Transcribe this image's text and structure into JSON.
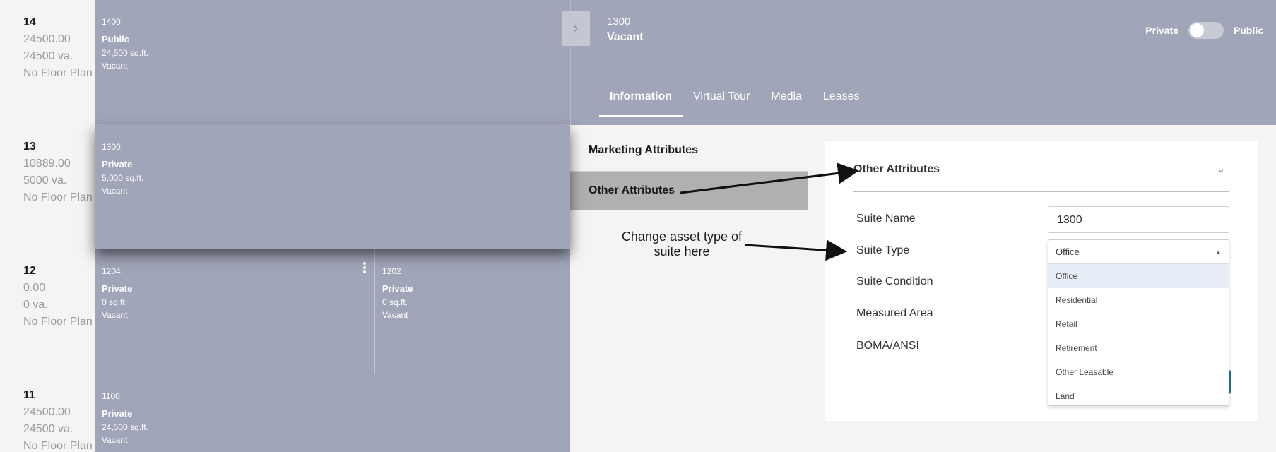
{
  "floors": [
    {
      "number": "14",
      "area": "24500.00",
      "va": "24500 va.",
      "plan": "No Floor Plan"
    },
    {
      "number": "13",
      "area": "10889.00",
      "va": "5000 va.",
      "plan": "No Floor Plan"
    },
    {
      "number": "12",
      "area": "0.00",
      "va": "0 va.",
      "plan": "No Floor Plan"
    },
    {
      "number": "11",
      "area": "24500.00",
      "va": "24500 va.",
      "plan": "No Floor Plan"
    }
  ],
  "suites": [
    {
      "number": "1400",
      "type": "Public",
      "size": "24,500 sq.ft.",
      "status": "Vacant"
    },
    {
      "number": "1300",
      "type": "Private",
      "size": "5,000 sq.ft.",
      "status": "Vacant"
    },
    {
      "number": "1204",
      "type": "Private",
      "size": "0 sq.ft.",
      "status": "Vacant"
    },
    {
      "number": "1202",
      "type": "Private",
      "size": "0 sq.ft.",
      "status": "Vacant"
    },
    {
      "number": "1100",
      "type": "Private",
      "size": "24,500 sq.ft.",
      "status": "Vacant"
    }
  ],
  "panel": {
    "suite_number": "1300",
    "status": "Vacant",
    "toggle": {
      "left": "Private",
      "right": "Public"
    },
    "tabs": [
      "Information",
      "Virtual Tour",
      "Media",
      "Leases"
    ],
    "side_nav": [
      "Marketing Attributes",
      "Other Attributes"
    ],
    "section_title": "Other Attributes",
    "fields": {
      "suite_name_label": "Suite Name",
      "suite_name_value": "1300",
      "suite_type_label": "Suite Type",
      "suite_condition_label": "Suite Condition",
      "measured_area_label": "Measured Area",
      "boma_label": "BOMA/ANSI"
    },
    "suite_type_selected": "Office",
    "suite_type_options": [
      "Office",
      "Residential",
      "Retail",
      "Retirement",
      "Other Leasable",
      "Land"
    ]
  },
  "annotation": "Change asset type of suite here",
  "icons": {
    "expand": "chevron-right-icon",
    "collapse": "chevron-down-icon",
    "dropdown": "caret-up-icon",
    "menu": "kebab-menu-icon"
  },
  "colors": {
    "suite_bg": "#a1a5b9",
    "active_nav": "#b0b0b0",
    "button": "#1b6f9c"
  }
}
